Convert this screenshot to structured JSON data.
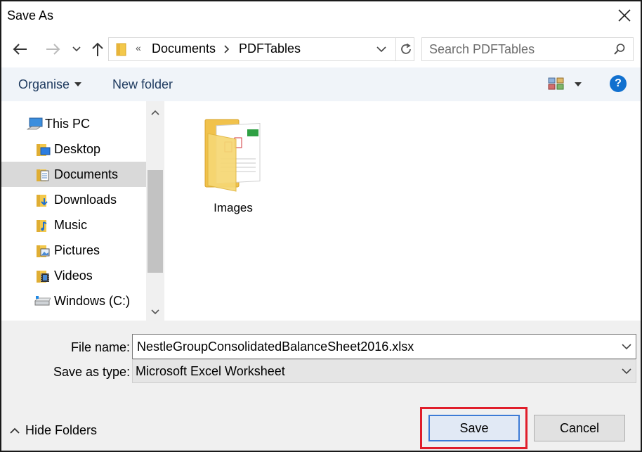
{
  "window": {
    "title": "Save As"
  },
  "address": {
    "root_marker": "«",
    "crumbs": [
      "Documents",
      "PDFTables"
    ]
  },
  "search": {
    "placeholder": "Search PDFTables"
  },
  "toolbar": {
    "organise_label": "Organise",
    "new_folder_label": "New folder",
    "help_label": "?"
  },
  "nav": {
    "items": [
      {
        "label": "This PC",
        "icon": "computer-icon"
      },
      {
        "label": "Desktop",
        "icon": "desktop-folder-icon"
      },
      {
        "label": "Documents",
        "icon": "documents-folder-icon",
        "selected": true
      },
      {
        "label": "Downloads",
        "icon": "downloads-folder-icon"
      },
      {
        "label": "Music",
        "icon": "music-folder-icon"
      },
      {
        "label": "Pictures",
        "icon": "pictures-folder-icon"
      },
      {
        "label": "Videos",
        "icon": "videos-folder-icon"
      },
      {
        "label": "Windows (C:)",
        "icon": "drive-icon"
      }
    ]
  },
  "files": [
    {
      "name": "Images",
      "type": "folder"
    }
  ],
  "form": {
    "file_name_label": "File name:",
    "file_name_value": "NestleGroupConsolidatedBalanceSheet2016.xlsx",
    "save_type_label": "Save as type:",
    "save_type_value": "Microsoft Excel Worksheet"
  },
  "footer": {
    "hide_folders_label": "Hide Folders",
    "save_label": "Save",
    "cancel_label": "Cancel"
  },
  "colors": {
    "accent": "#1170cf",
    "highlight": "#e01e2a",
    "toolbar_bg": "#f0f4f9",
    "selected_bg": "#d9d9d9"
  }
}
